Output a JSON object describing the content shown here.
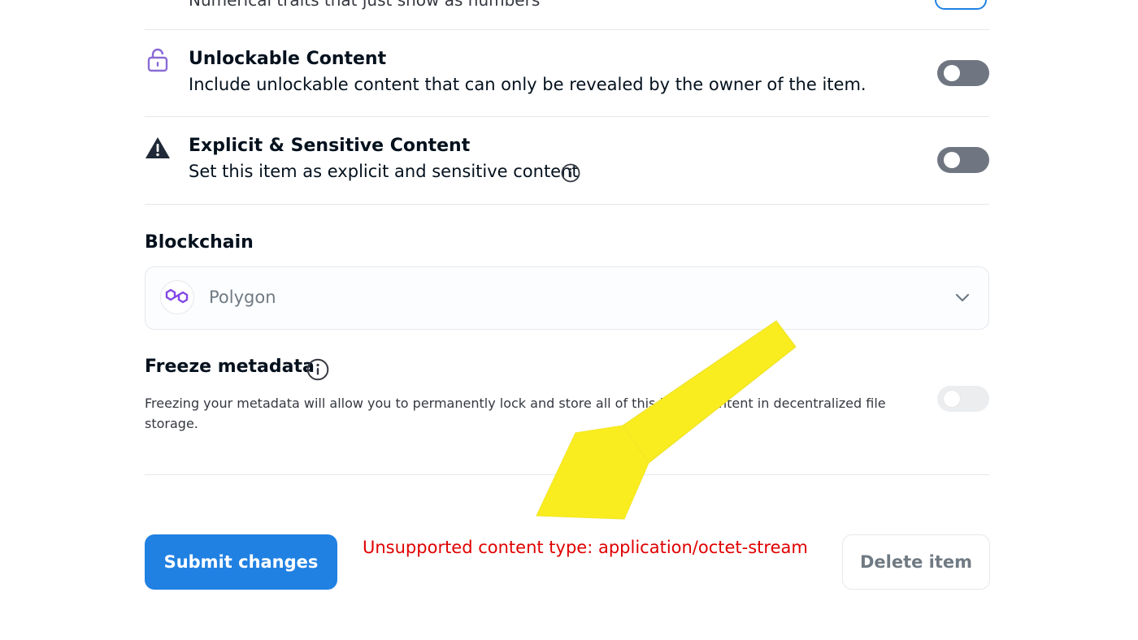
{
  "top_row": {
    "description": "Numerical traits that just show as numbers"
  },
  "unlockable": {
    "icon": "padlock-icon",
    "title": "Unlockable Content",
    "description": "Include unlockable content that can only be revealed by the owner of the item.",
    "enabled": false
  },
  "explicit": {
    "icon": "warning-triangle-icon",
    "title": "Explicit & Sensitive Content",
    "description": "Set this item as explicit and sensitive content",
    "info_icon": "info-icon",
    "enabled": false
  },
  "blockchain": {
    "label": "Blockchain",
    "selected": "Polygon",
    "icon": "polygon-logo-icon"
  },
  "freeze": {
    "label": "Freeze metadata",
    "description": "Freezing your metadata will allow you to permanently lock and store all of this item's content in decentralized file storage.",
    "enabled": false,
    "disabled": true
  },
  "actions": {
    "submit_label": "Submit changes",
    "error_message": "Unsupported content type: application/octet-stream",
    "delete_label": "Delete item"
  },
  "colors": {
    "accent": "#2081e2",
    "error": "#e00000",
    "annotation_arrow": "#f9ec1f",
    "lock_icon": "#8a6bd6",
    "polygon": "#8247e5"
  }
}
